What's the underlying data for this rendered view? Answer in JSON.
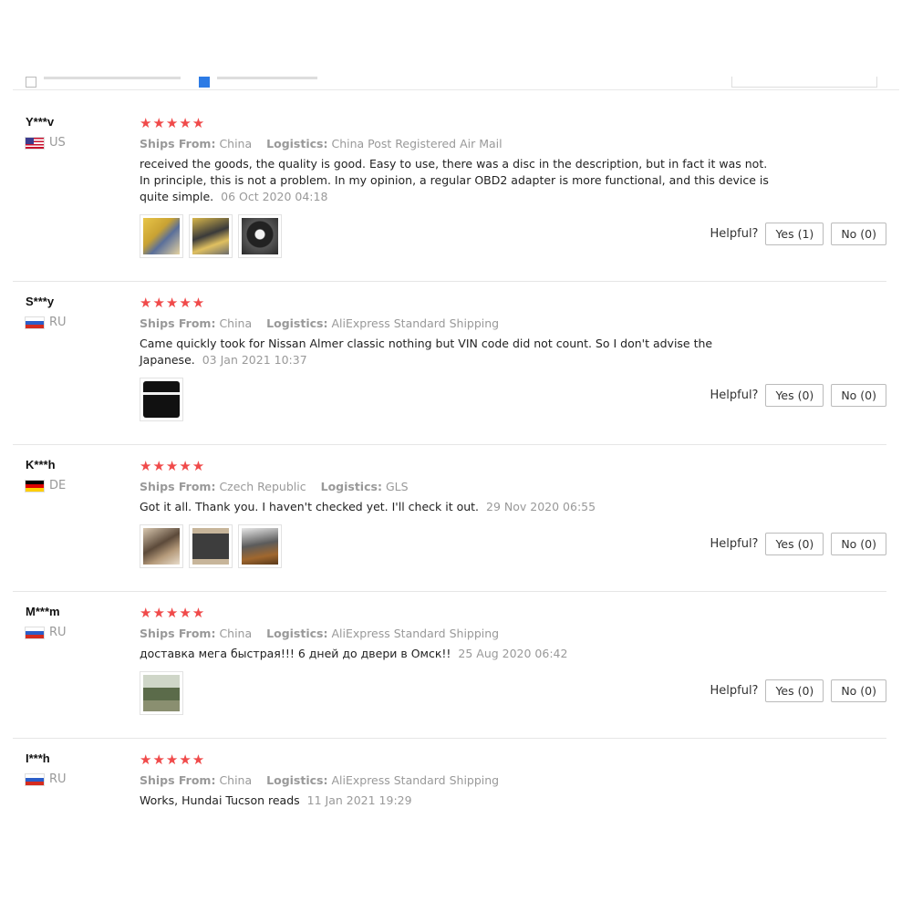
{
  "helpful_label": "Helpful?",
  "reviews": [
    {
      "user": "Y***v",
      "country": "US",
      "ships_from_label": "Ships From:",
      "ships_from": "China",
      "logistics_label": "Logistics:",
      "logistics": "China Post Registered Air Mail",
      "text": "received the goods, the quality is good. Easy to use, there was a disc in the description, but in fact it was not. In principle, this is not a problem. In my opinion, a regular OBD2 adapter is more functional, and this device is quite simple.",
      "date": "06 Oct 2020 04:18",
      "yes": "Yes (1)",
      "no": "No (0)"
    },
    {
      "user": "S***y",
      "country": "RU",
      "ships_from_label": "Ships From:",
      "ships_from": "China",
      "logistics_label": "Logistics:",
      "logistics": "AliExpress Standard Shipping",
      "text": "Came quickly took for Nissan Almer classic nothing but VIN code did not count. So I don't advise the Japanese.",
      "date": "03 Jan 2021 10:37",
      "yes": "Yes (0)",
      "no": "No (0)"
    },
    {
      "user": "K***h",
      "country": "DE",
      "ships_from_label": "Ships From:",
      "ships_from": "Czech Republic",
      "logistics_label": "Logistics:",
      "logistics": "GLS",
      "text": "Got it all. Thank you. I haven't checked yet. I'll check it out.",
      "date": "29 Nov 2020 06:55",
      "yes": "Yes (0)",
      "no": "No (0)"
    },
    {
      "user": "M***m",
      "country": "RU",
      "ships_from_label": "Ships From:",
      "ships_from": "China",
      "logistics_label": "Logistics:",
      "logistics": "AliExpress Standard Shipping",
      "text": "доставка мега быстрая!!! 6 дней до двери в Омск!!",
      "date": "25 Aug 2020 06:42",
      "yes": "Yes (0)",
      "no": "No (0)"
    },
    {
      "user": "I***h",
      "country": "RU",
      "ships_from_label": "Ships From:",
      "ships_from": "China",
      "logistics_label": "Logistics:",
      "logistics": "AliExpress Standard Shipping",
      "text": "Works, Hundai Tucson reads",
      "date": "11 Jan 2021 19:29"
    }
  ]
}
